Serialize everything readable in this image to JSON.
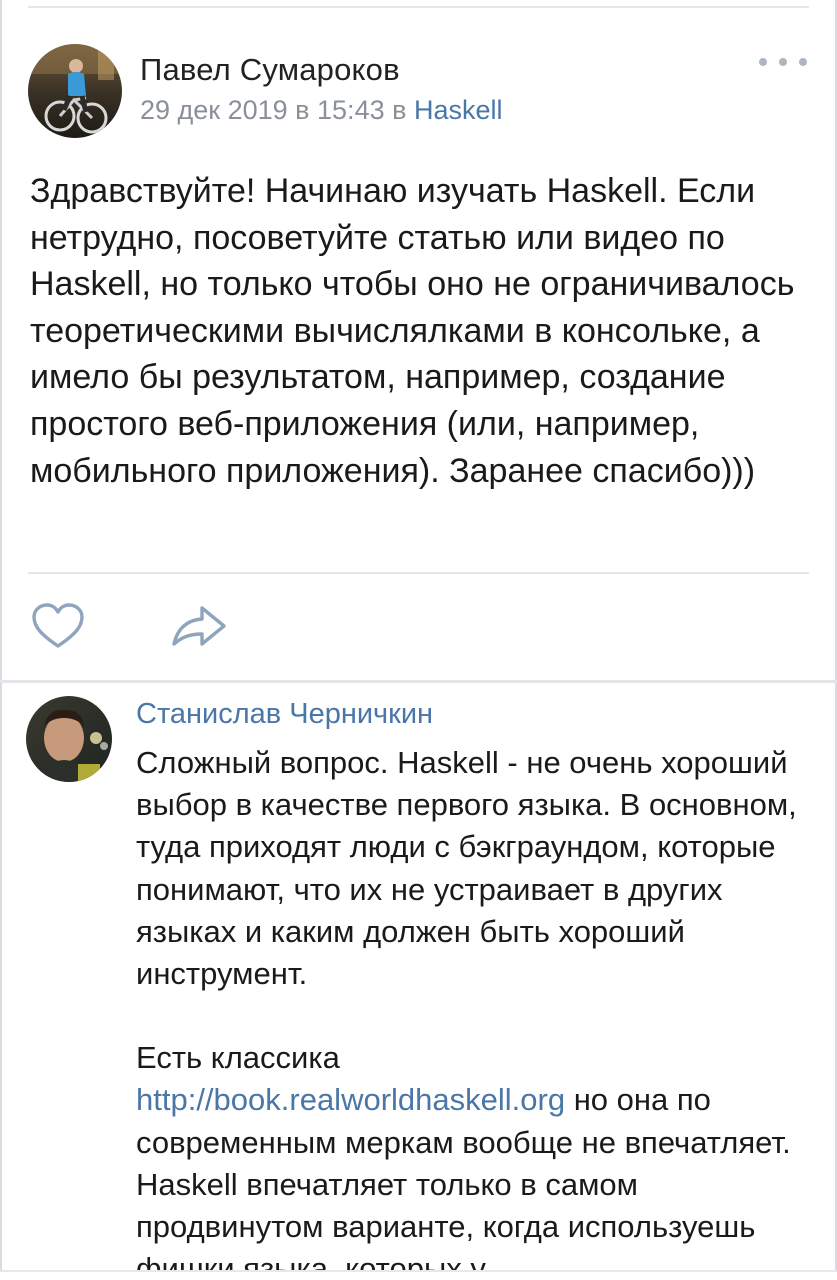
{
  "post": {
    "author": "Павел Сумароков",
    "date": "29 дек 2019 в 15:43 в ",
    "group": "Haskell",
    "text": "Здравствуйте! Начинаю изучать Haskell. Если нетрудно, посоветуйте статью или видео по Haskell, но только чтобы оно не ограничивалось теоретическими вычислялками в консольке, а имело бы результатом, например, создание простого веб-приложения (или, например, мобильного приложения). Заранее спасибо)))",
    "avatar_icon": "avatar-cyclist-photo",
    "more_icon": "more-dots-icon"
  },
  "actions": {
    "like_icon": "heart-icon",
    "share_icon": "share-arrow-icon"
  },
  "comment": {
    "author": "Станислав Черничкин",
    "avatar_icon": "avatar-portrait-photo",
    "paragraph1": "Сложный вопрос. Haskell - не очень хороший выбор в качестве первого языка. В основном, туда приходят люди с бэкграундом, которые понимают, что их не устраивает в других языках и каким должен быть хороший инструмент.",
    "p2_intro": "Есть классика",
    "p2_link": "http://book.realworldhaskell.org",
    "p2_rest": " но она по современным меркам вообще не впечатляет. Haskell впечатляет только в самом продвинутом варианте, когда используешь фишки языка, которых у"
  },
  "colors": {
    "link": "#4a76a8",
    "meta": "#8a9099",
    "divider": "#e3e5e8",
    "icon": "#8fa4bd"
  }
}
